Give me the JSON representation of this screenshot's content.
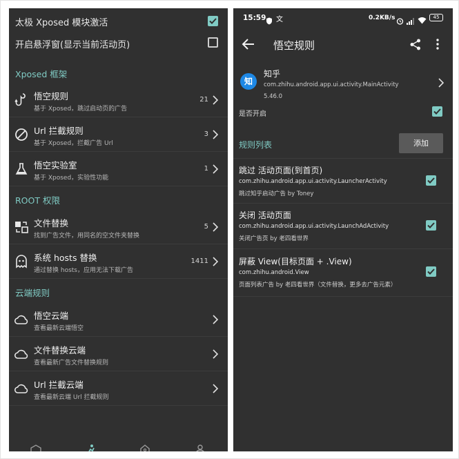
{
  "left": {
    "toggles": [
      {
        "label": "太极 Xposed 模块激活",
        "checked": true
      },
      {
        "label": "开启悬浮窗(显示当前活动页)",
        "checked": false
      }
    ],
    "sections": {
      "xposed": "Xposed 框架",
      "root": "ROOT 权限",
      "cloud": "云端规则"
    },
    "items": [
      {
        "title": "悟空规则",
        "subtitle": "基于 Xposed，跳过启动页的广告",
        "count": "21",
        "icon": "hook-icon"
      },
      {
        "title": "Url 拦截规则",
        "subtitle": "基于 Xposed，拦截广告 Url",
        "count": "3",
        "icon": "block-icon"
      },
      {
        "title": "悟空实验室",
        "subtitle": "基于 Xposed，实验性功能",
        "count": "1",
        "icon": "flask-icon"
      },
      {
        "title": "文件替换",
        "subtitle": "找到广告文件，用同名的空文件夹替换",
        "count": "5",
        "icon": "file-swap-icon"
      },
      {
        "title": "系统 hosts 替换",
        "subtitle": "通过替换 hosts，应用无法下载广告",
        "count": "1411",
        "icon": "ghost-icon"
      },
      {
        "title": "悟空云端",
        "subtitle": "查看最新云端悟空",
        "count": "",
        "icon": "cloud-icon"
      },
      {
        "title": "文件替换云端",
        "subtitle": "查看最新广告文件替换规则",
        "count": "",
        "icon": "cloud-icon"
      },
      {
        "title": "Url 拦截云端",
        "subtitle": "查看最新云端 Url 拦截规则",
        "count": "",
        "icon": "cloud-icon"
      }
    ]
  },
  "right": {
    "status": {
      "time": "15:59",
      "speed": "0.2KB/s",
      "battery": "45"
    },
    "title": "悟空规则",
    "app": {
      "avatar": "知",
      "name": "知乎",
      "package": "com.zhihu.android.app.ui.activity.MainActivity",
      "version": "5.46.0"
    },
    "enabled_label": "是否开启",
    "enabled": true,
    "rules_section": "规则列表",
    "add_label": "添加",
    "rules": [
      {
        "title": "跳过 活动页面(到首页)",
        "activity": "com.zhihu.android.app.ui.activity.LauncherActivity",
        "note": "跳过知乎启动广告 by Toney",
        "checked": true
      },
      {
        "title": "关闭 活动页面",
        "activity": "com.zhihu.android.app.ui.activity.LaunchAdActivity",
        "note": "关闭广告页  by 老四看世界",
        "checked": true
      },
      {
        "title": "屏蔽 View(目标页面 + .View)",
        "activity": "com.zhihu.android.View",
        "note": "页面列表广告  by 老四看世界（文件替换，更多去广告元素）",
        "checked": true
      }
    ]
  },
  "colors": {
    "accent": "#80cbc4",
    "panel": "#303030",
    "divider": "#3c3c3c",
    "button": "#5a5a5a",
    "avatar": "#1e88e5"
  }
}
